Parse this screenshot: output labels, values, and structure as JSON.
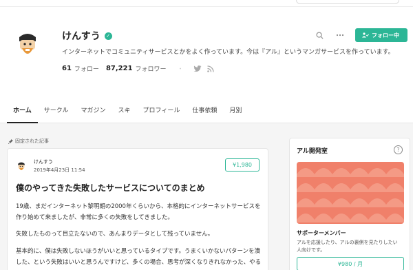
{
  "profile": {
    "name": "けんすう",
    "bio": "インターネットでコミュニティサービスとかをよく作っています。今は『アル』というマンガサービスを作っています。",
    "following_count": "61",
    "following_label": "フォロー",
    "followers_count": "87,221",
    "followers_label": "フォロワー",
    "dot": "・"
  },
  "actions": {
    "follow_label": "フォロー中",
    "search_icon": "search-icon",
    "more_icon": "more-icon"
  },
  "tabs": [
    {
      "label": "ホーム"
    },
    {
      "label": "サークル"
    },
    {
      "label": "マガジン"
    },
    {
      "label": "スキ"
    },
    {
      "label": "プロフィール"
    },
    {
      "label": "仕事依頼"
    },
    {
      "label": "月別"
    }
  ],
  "pinned": {
    "label": "固定された記事",
    "author": "けんすう",
    "date": "2019年4月23日 11:54",
    "price": "¥1,980",
    "title": "僕のやってきた失敗したサービスについてのまとめ",
    "paragraphs": [
      "19歳、まだインターネット黎明期の2000年くらいから、本格的にインターネットサービスを作り始めて来ましたが、非常に多くの失敗をしてきました。",
      "失敗したものって目立たないので、あんまりデータとして残っていません。",
      "基本的に、僕は失敗しないほうがいいと思っているタイプです。うまくいかないパターンを潰した、という失敗はいいと思うんですけど、多くの場合、思考が深くなりきれなかった、やるべきことをや"
    ]
  },
  "sidebar": {
    "title": "アル開発室",
    "help": "?",
    "plan_name": "サポーターメンバー",
    "plan_desc": "アルを応援したり、アルの裏側を見たりしたい人向けです。",
    "plan_price": "¥980 / 月"
  },
  "colors": {
    "accent": "#2cb696",
    "banner": "#f0806a"
  }
}
